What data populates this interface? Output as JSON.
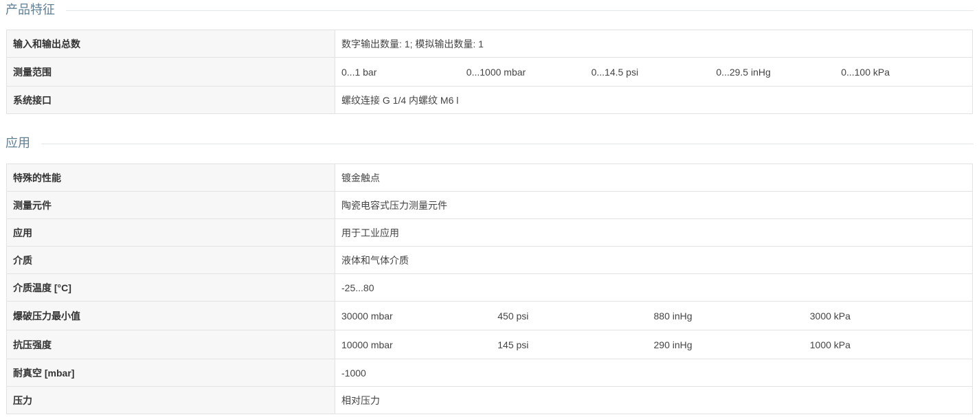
{
  "sections": {
    "features": {
      "title": "产品特征",
      "rows": [
        {
          "label": "输入和输出总数",
          "value": "数字输出数量: 1; 模拟输出数量: 1"
        },
        {
          "label": "测量范围",
          "values": [
            "0...1 bar",
            "0...1000 mbar",
            "0...14.5 psi",
            "0...29.5 inHg",
            "0...100 kPa"
          ]
        },
        {
          "label": "系统接口",
          "value": "螺纹连接 G 1/4 内螺纹 M6 l"
        }
      ]
    },
    "application": {
      "title": "应用",
      "rows": [
        {
          "label": "特殊的性能",
          "value": "镀金触点"
        },
        {
          "label": "测量元件",
          "value": "陶瓷电容式压力测量元件"
        },
        {
          "label": "应用",
          "value": "用于工业应用"
        },
        {
          "label": "介质",
          "value": "液体和气体介质"
        },
        {
          "label": "介质温度 [°C]",
          "value": "-25...80"
        },
        {
          "label": "爆破压力最小值",
          "values": [
            "30000 mbar",
            "450 psi",
            "880 inHg",
            "3000 kPa"
          ]
        },
        {
          "label": "抗压强度",
          "values": [
            "10000 mbar",
            "145 psi",
            "290 inHg",
            "1000 kPa"
          ]
        },
        {
          "label": "耐真空 [mbar]",
          "value": "-1000"
        },
        {
          "label": "压力",
          "value": "相对压力"
        }
      ]
    }
  }
}
